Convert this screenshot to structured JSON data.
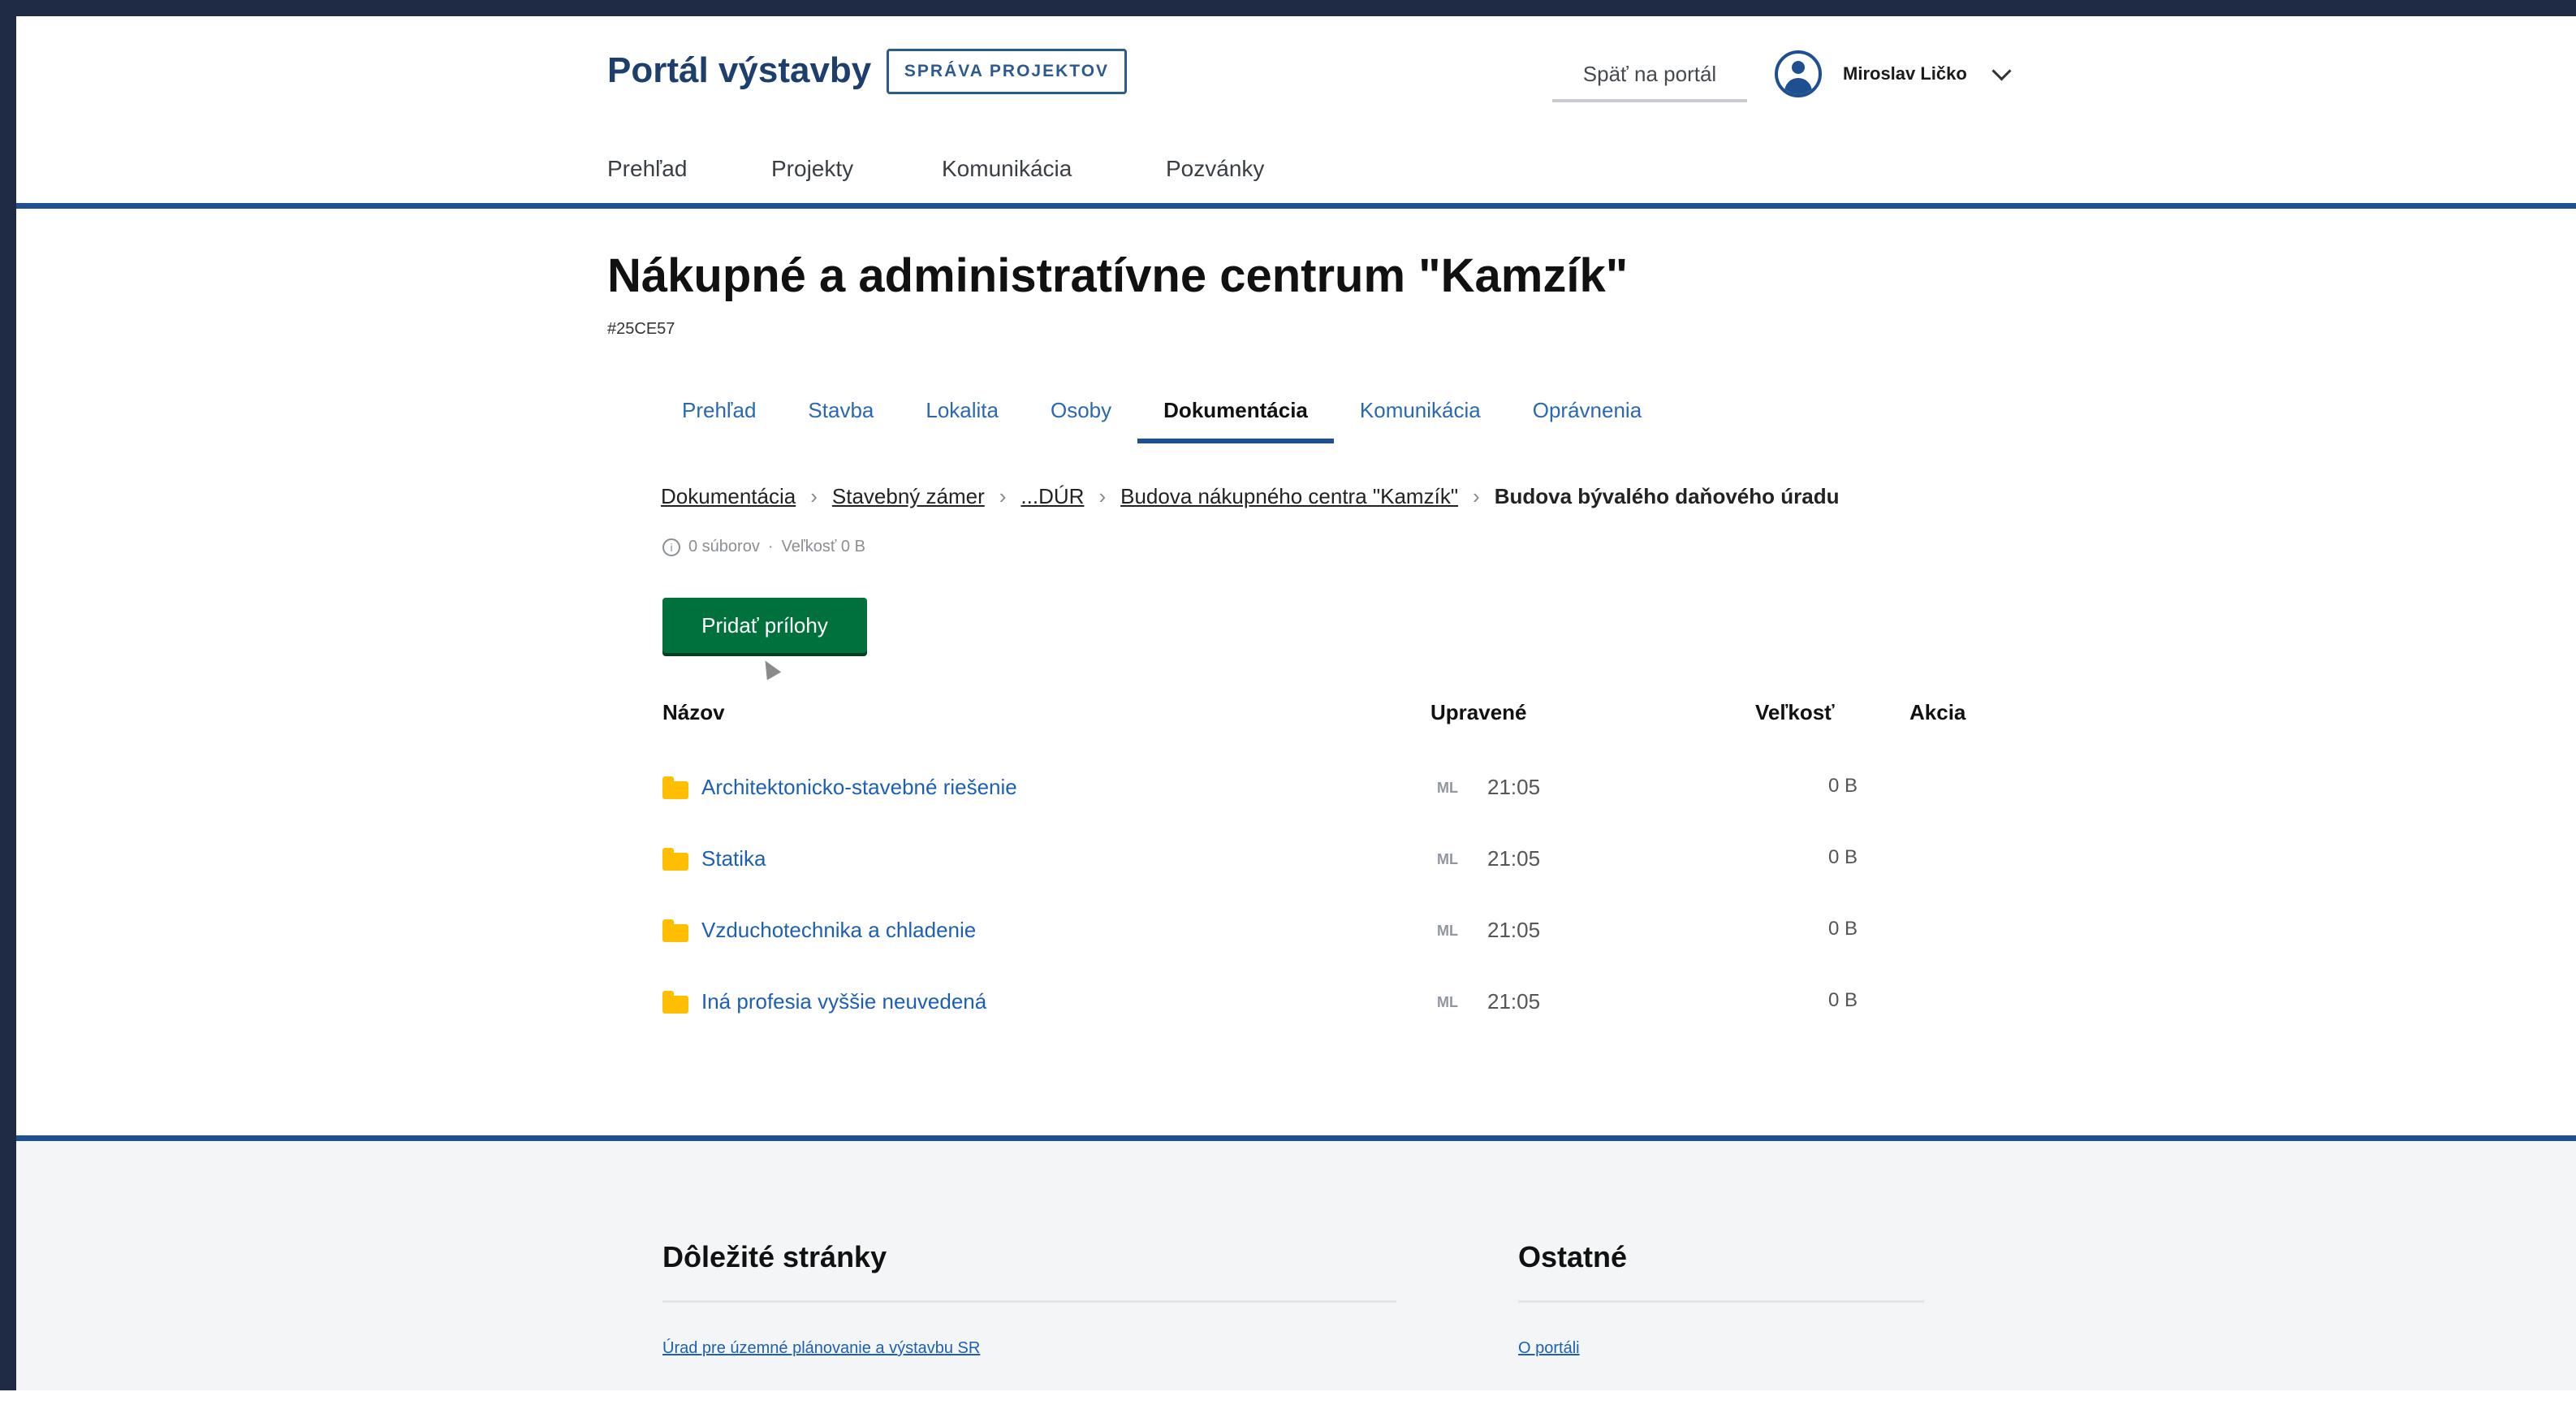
{
  "header": {
    "brand": "Portál výstavby",
    "badge": "SPRÁVA PROJEKTOV",
    "back_link": "Späť na portál",
    "user_name": "Miroslav Ličko",
    "nav": [
      "Prehľad",
      "Projekty",
      "Komunikácia",
      "Pozvánky"
    ]
  },
  "project": {
    "title": "Nákupné a administratívne centrum \"Kamzík\"",
    "code": "#25CE57",
    "tabs": [
      "Prehľad",
      "Stavba",
      "Lokalita",
      "Osoby",
      "Dokumentácia",
      "Komunikácia",
      "Oprávnenia"
    ],
    "active_tab": "Dokumentácia"
  },
  "breadcrumb": {
    "items": [
      "Dokumentácia",
      "Stavebný zámer",
      "...",
      "DÚR",
      "Budova nákupného centra \"Kamzík\"",
      "Budova bývalého daňového úradu"
    ]
  },
  "folder_meta": {
    "items_text": "0 súborov",
    "size_text": "Veľkosť 0 B"
  },
  "actions": {
    "add_attachments": "Pridať prílohy"
  },
  "table": {
    "headers": {
      "name": "Názov",
      "modified": "Upravené",
      "size": "Veľkosť",
      "action": "Akcia"
    },
    "rows": [
      {
        "name": "Architektonicko-stavebné riešenie",
        "initials": "ML",
        "time": "21:05",
        "size": "0 B"
      },
      {
        "name": "Statika",
        "initials": "ML",
        "time": "21:05",
        "size": "0 B"
      },
      {
        "name": "Vzduchotechnika a chladenie",
        "initials": "ML",
        "time": "21:05",
        "size": "0 B"
      },
      {
        "name": "Iná profesia vyššie neuvedená",
        "initials": "ML",
        "time": "21:05",
        "size": "0 B"
      }
    ]
  },
  "footer": {
    "important_title": "Dôležité stránky",
    "important_link": "Úrad pre územné plánovanie a výstavbu SR",
    "other_title": "Ostatné",
    "other_link": "O portáli"
  },
  "colors": {
    "brand_blue": "#1d4f91",
    "link_blue": "#1d5fb4",
    "primary_green": "#00703c",
    "folder_yellow": "#ffbf00"
  }
}
